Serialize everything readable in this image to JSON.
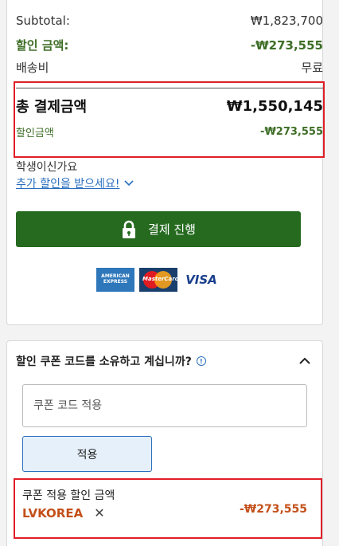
{
  "summary": {
    "subtotal_label": "Subtotal:",
    "subtotal_value": "₩1,823,700",
    "discount_label": "할인 금액:",
    "discount_value": "-₩273,555",
    "shipping_label": "배송비",
    "shipping_value": "무료",
    "total_label": "총 결제금액",
    "total_value": "₩1,550,145",
    "total_discount_label": "할인금액",
    "total_discount_value": "-₩273,555"
  },
  "student": {
    "question": "학생이신가요",
    "link": "추가 할인을 받으세요!"
  },
  "checkout": {
    "button_label": "결제 진행"
  },
  "payment_icons": [
    "amex-icon",
    "mastercard-icon",
    "visa-icon"
  ],
  "payment_text": {
    "amex_line1": "AMERICAN",
    "amex_line2": "EXPRESS",
    "mastercard": "MasterCard",
    "visa": "VISA"
  },
  "coupon": {
    "heading": "할인 쿠폰 코드를 소유하고 계십니까?",
    "input_placeholder": "쿠폰 코드 적용",
    "apply_label": "적용",
    "applied_label": "쿠폰 적용 할인 금액",
    "applied_code": "LVKOREA",
    "applied_amount": "-₩273,555"
  },
  "colors": {
    "green": "#256a1f",
    "accent_red": "#e01e28",
    "coupon_orange": "#c4501a",
    "link_blue": "#2a6fbf"
  }
}
